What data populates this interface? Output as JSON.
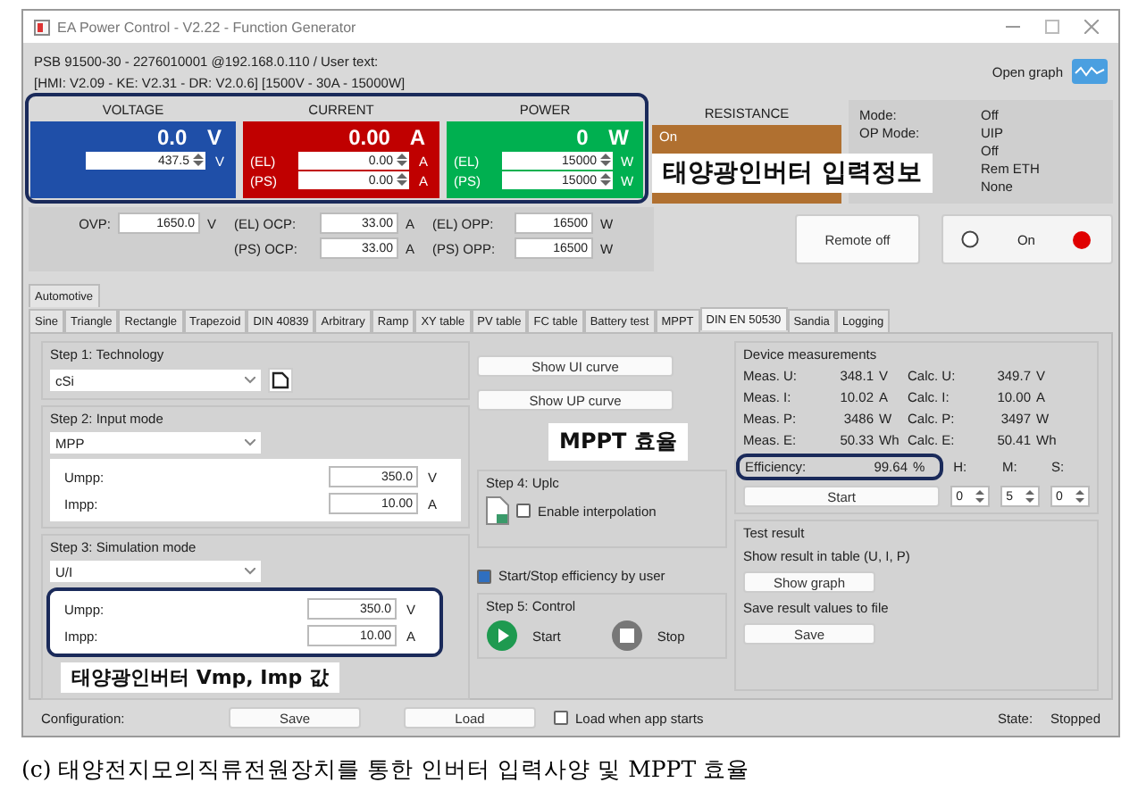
{
  "window": {
    "title": "EA Power Control - V2.22 - Function Generator"
  },
  "device": {
    "line1": "PSB 91500-30 - 2276010001 @192.168.0.110 / User text:",
    "line2": "[HMI: V2.09 - KE: V2.31 - DR: V2.0.6] [1500V - 30A - 15000W]",
    "open_graph": "Open graph"
  },
  "meters": [
    {
      "kind": "setpoint",
      "heading": "VOLTAGE",
      "value": "0.0",
      "unit": "V",
      "color": "#1f4fa8",
      "setpoints": [
        {
          "value": "437.5",
          "unit": "V"
        }
      ]
    },
    {
      "kind": "setpoint",
      "heading": "CURRENT",
      "value": "0.00",
      "unit": "A",
      "color": "#c00000",
      "setpoints": [
        {
          "prefix": "(EL)",
          "value": "0.00",
          "unit": "A"
        },
        {
          "prefix": "(PS)",
          "value": "0.00",
          "unit": "A"
        }
      ]
    },
    {
      "kind": "setpoint",
      "heading": "POWER",
      "value": "0",
      "unit": "W",
      "color": "#00b050",
      "setpoints": [
        {
          "prefix": "(EL)",
          "value": "15000",
          "unit": "W"
        },
        {
          "prefix": "(PS)",
          "value": "15000",
          "unit": "W"
        }
      ]
    },
    {
      "kind": "state",
      "heading": "RESISTANCE",
      "value": "On",
      "color": "#b07030"
    }
  ],
  "meter_annotation": {
    "text": "태양광인버터 입력정보"
  },
  "status": [
    {
      "label": "Mode:",
      "value": "Off"
    },
    {
      "label": "OP Mode:",
      "value": "UIP"
    },
    {
      "value": "Off"
    },
    {
      "value": "Rem ETH"
    },
    {
      "value": "None"
    }
  ],
  "protection": {
    "ovp": {
      "label": "OVP:",
      "value": "1650.0",
      "unit": "V"
    },
    "ocp": [
      {
        "label": "(EL) OCP:",
        "value": "33.00",
        "unit": "A"
      },
      {
        "label": "(PS) OCP:",
        "value": "33.00",
        "unit": "A"
      }
    ],
    "opp": [
      {
        "label": "(EL) OPP:",
        "value": "16500",
        "unit": "W"
      },
      {
        "label": "(PS) OPP:",
        "value": "16500",
        "unit": "W"
      }
    ]
  },
  "remote_button": "Remote off",
  "output": {
    "label": "On",
    "selected": false
  },
  "tabs_top": [
    {
      "label": "Automotive",
      "selected": false
    }
  ],
  "tabs": [
    {
      "label": "Sine",
      "selected": false
    },
    {
      "label": "Triangle",
      "selected": false
    },
    {
      "label": "Rectangle",
      "selected": false
    },
    {
      "label": "Trapezoid",
      "selected": false
    },
    {
      "label": "DIN 40839",
      "selected": false
    },
    {
      "label": "Arbitrary",
      "selected": false
    },
    {
      "label": "Ramp",
      "selected": false
    },
    {
      "label": "XY table",
      "selected": false
    },
    {
      "label": "PV table",
      "selected": false
    },
    {
      "label": "FC table",
      "selected": false
    },
    {
      "label": "Battery test",
      "selected": false
    },
    {
      "label": "MPPT",
      "selected": false
    },
    {
      "label": "DIN EN 50530",
      "selected": true
    },
    {
      "label": "Sandia",
      "selected": false
    },
    {
      "label": "Logging",
      "selected": false
    }
  ],
  "technology": {
    "title": "Step 1: Technology",
    "value": "cSi"
  },
  "input_mode": {
    "title": "Step 2: Input mode",
    "value": "MPP",
    "fields": [
      {
        "label": "Umpp:",
        "value": "350.0",
        "unit": "V"
      },
      {
        "label": "Impp:",
        "value": "10.00",
        "unit": "A"
      }
    ]
  },
  "simulation": {
    "title": "Step 3: Simulation mode",
    "value": "U/I",
    "fields": [
      {
        "label": "Umpp:",
        "value": "350.0",
        "unit": "V"
      },
      {
        "label": "Impp:",
        "value": "10.00",
        "unit": "A"
      }
    ],
    "annotation": "태양광인버터 Vmp, Imp 값"
  },
  "curve_buttons": [
    "Show UI curve",
    "Show UP curve"
  ],
  "upload": {
    "title": "Step 4: Uplc",
    "interpolation": {
      "label": "Enable interpolation",
      "checked": false
    }
  },
  "start_stop": {
    "label": "Start/Stop efficiency by user",
    "checked": true
  },
  "control": {
    "title": "Step 5: Control",
    "start": "Start",
    "stop": "Stop"
  },
  "measurements": {
    "title": "Device measurements",
    "rows": [
      {
        "meas_label": "Meas. U:",
        "meas_value": "348.1",
        "meas_unit": "V",
        "calc_label": "Calc. U:",
        "calc_value": "349.7",
        "calc_unit": "V"
      },
      {
        "meas_label": "Meas. I:",
        "meas_value": "10.02",
        "meas_unit": "A",
        "calc_label": "Calc. I:",
        "calc_value": "10.00",
        "calc_unit": "A"
      },
      {
        "meas_label": "Meas. P:",
        "meas_value": "3486",
        "meas_unit": "W",
        "calc_label": "Calc. P:",
        "calc_value": "3497",
        "calc_unit": "W"
      },
      {
        "meas_label": "Meas. E:",
        "meas_value": "50.33",
        "meas_unit": "Wh",
        "calc_label": "Calc. E:",
        "calc_value": "50.41",
        "calc_unit": "Wh"
      }
    ],
    "efficiency": {
      "label": "Efficiency:",
      "value": "99.64",
      "unit": "%"
    },
    "annotation": "MPPT 효율",
    "start": "Start",
    "timer": [
      {
        "label": "H:",
        "value": "0"
      },
      {
        "label": "M:",
        "value": "5"
      },
      {
        "label": "S:",
        "value": "0"
      }
    ]
  },
  "test_result": {
    "title": "Test result",
    "table_label": "Show result in table (U, I, P)",
    "graph_button": "Show graph",
    "save_label": "Save result values to file",
    "save_button": "Save"
  },
  "footer": {
    "label": "Configuration:",
    "save": "Save",
    "load": "Load",
    "load_on_start": {
      "label": "Load when app starts",
      "checked": false
    },
    "state_label": "State:",
    "state": "Stopped"
  },
  "caption": "(c) 태양전지모의직류전원장치를 통한 인버터 입력사양 및 MPPT 효율"
}
